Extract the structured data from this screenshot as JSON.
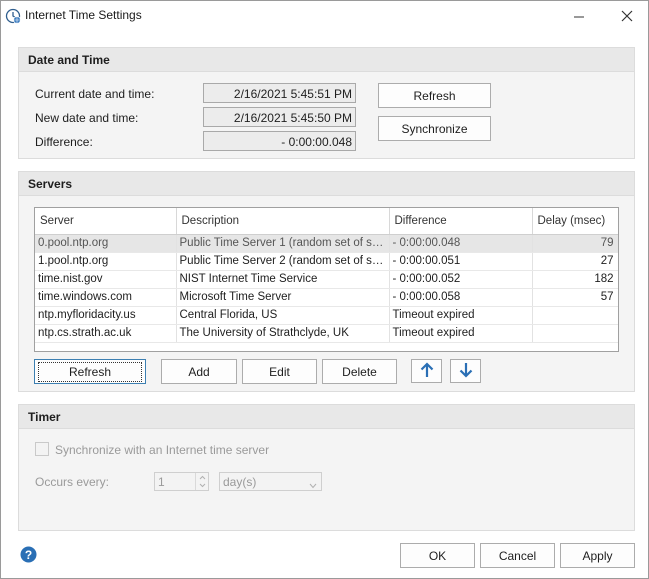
{
  "window": {
    "title": "Internet Time Settings"
  },
  "date_time": {
    "header": "Date and Time",
    "current_label": "Current date and time:",
    "current_value": "2/16/2021 5:45:51 PM",
    "new_label": "New date and time:",
    "new_value": "2/16/2021 5:45:50 PM",
    "difference_label": "Difference:",
    "difference_value": "- 0:00:00.048",
    "refresh_label": "Refresh",
    "synchronize_label": "Synchronize"
  },
  "servers": {
    "header": "Servers",
    "columns": [
      "Server",
      "Description",
      "Difference",
      "Delay (msec)"
    ],
    "rows": [
      {
        "server": "0.pool.ntp.org",
        "description": "Public Time Server 1 (random set of serv...",
        "difference": "- 0:00:00.048",
        "delay": "79",
        "selected": true
      },
      {
        "server": "1.pool.ntp.org",
        "description": "Public Time Server 2 (random set of serv...",
        "difference": "- 0:00:00.051",
        "delay": "27"
      },
      {
        "server": "time.nist.gov",
        "description": "NIST Internet Time Service",
        "difference": "- 0:00:00.052",
        "delay": "182"
      },
      {
        "server": "time.windows.com",
        "description": "Microsoft Time Server",
        "difference": "- 0:00:00.058",
        "delay": "57"
      },
      {
        "server": "ntp.myfloridacity.us",
        "description": "Central Florida, US",
        "difference": "Timeout expired",
        "delay": ""
      },
      {
        "server": "ntp.cs.strath.ac.uk",
        "description": "The University of Strathclyde, UK",
        "difference": "Timeout expired",
        "delay": ""
      }
    ],
    "refresh_label": "Refresh",
    "add_label": "Add",
    "edit_label": "Edit",
    "delete_label": "Delete",
    "move_up_icon": "arrow-up-icon",
    "move_down_icon": "arrow-down-icon"
  },
  "timer": {
    "header": "Timer",
    "sync_checkbox_label": "Synchronize with an Internet time server",
    "sync_checked": false,
    "occurs_label": "Occurs every:",
    "interval_value": "1",
    "unit_value": "day(s)"
  },
  "footer": {
    "ok_label": "OK",
    "cancel_label": "Cancel",
    "apply_label": "Apply"
  },
  "colors": {
    "accent_blue": "#2a6fb5",
    "group_bg": "#f4f4f4",
    "header_bg": "#e8e8e8"
  }
}
